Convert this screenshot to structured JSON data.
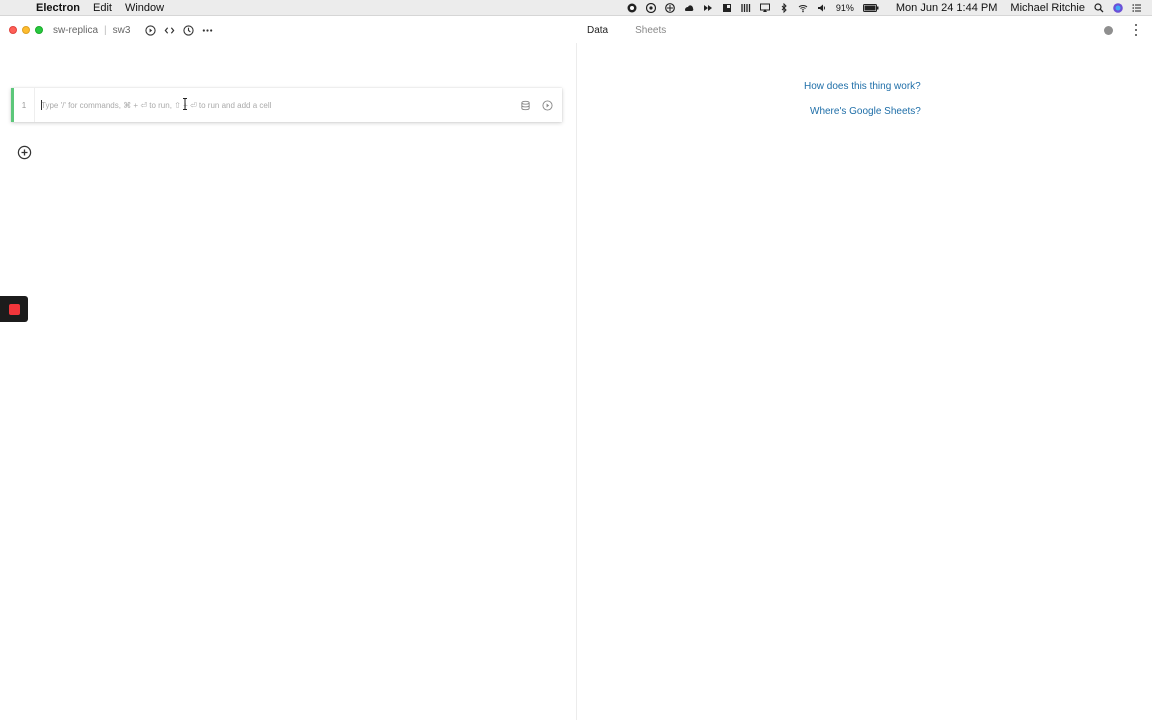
{
  "menubar": {
    "app_name": "Electron",
    "menus": [
      "Edit",
      "Window"
    ],
    "battery": "91%",
    "datetime": "Mon Jun 24  1:44 PM",
    "username": "Michael Ritchie"
  },
  "titlebar": {
    "project": "sw-replica",
    "notebook": "sw3",
    "tabs": {
      "data": "Data",
      "sheets": "Sheets"
    }
  },
  "cell": {
    "line_number": "1",
    "placeholder": "Type '/' for commands, ⌘ + ⏎ to run, ⇧ + ⏎ to run and add a cell"
  },
  "right_panel": {
    "help_link": "How does this thing work?",
    "sheets_link": "Where's Google Sheets?"
  },
  "colors": {
    "accent_green": "#5cc77a",
    "link_blue": "#1e6ea8",
    "record_red": "#f2363b"
  }
}
